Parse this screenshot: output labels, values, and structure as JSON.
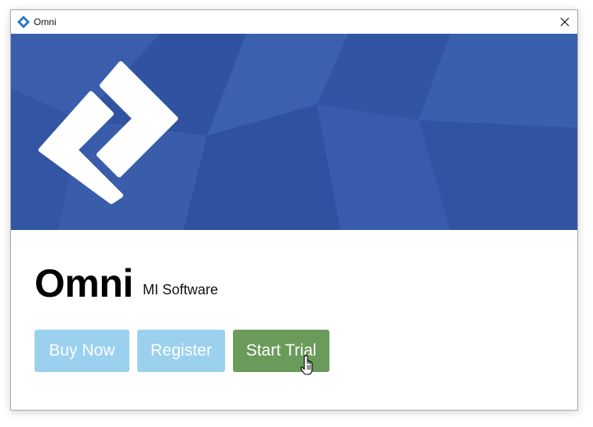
{
  "window": {
    "title": "Omni",
    "title_icon": "omni-logo-icon",
    "close_icon": "close-icon"
  },
  "banner": {
    "logo_icon": "omni-chevron-logo-icon",
    "colors": {
      "background": "#3558a6",
      "logo": "#ffffff"
    }
  },
  "app": {
    "name": "Omni",
    "vendor": "MI Software"
  },
  "buttons": {
    "buy_now": {
      "label": "Buy Now",
      "color": "#9bd1ef"
    },
    "register": {
      "label": "Register",
      "color": "#9bd1ef"
    },
    "start_trial": {
      "label": "Start Trial",
      "color": "#6b9b5a"
    }
  },
  "cursor": "hand-pointer-icon"
}
